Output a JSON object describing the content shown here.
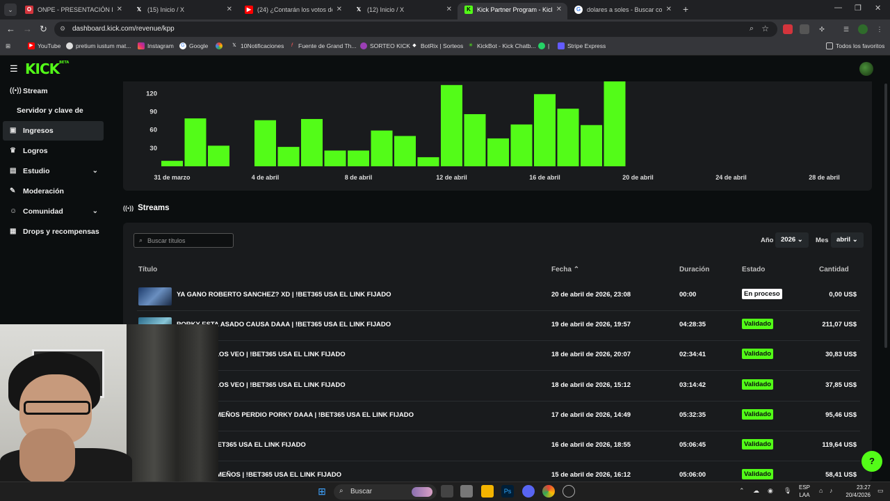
{
  "browser": {
    "tabs": [
      {
        "label": "ONPE - PRESENTACIÓN DE RES",
        "icon": "onpe-icon",
        "color": "#d3343c"
      },
      {
        "label": "(15) Inicio / X",
        "icon": "x-icon",
        "color": "#000000"
      },
      {
        "label": "(24) ¿Contarán los votos de act",
        "icon": "youtube-icon",
        "color": "#ff0000"
      },
      {
        "label": "(12) Inicio / X",
        "icon": "x-icon",
        "color": "#000000"
      },
      {
        "label": "Kick Partner Program - Kick Da",
        "icon": "kick-icon",
        "color": "#53fc18"
      },
      {
        "label": "dolares a soles - Buscar con Go",
        "icon": "google-icon",
        "color": "#4285f4"
      }
    ],
    "url": "dashboard.kick.com/revenue/kpp",
    "bookmarks": [
      {
        "label": "YouTube",
        "icon": "youtube-icon"
      },
      {
        "label": "pretium iustum mat...",
        "icon": "globe-icon"
      },
      {
        "label": "Instagram",
        "icon": "instagram-icon"
      },
      {
        "label": "Google",
        "icon": "google-icon"
      },
      {
        "label": "",
        "icon": "pinwheel-icon"
      },
      {
        "label": "10Notificaciones",
        "icon": "x-icon"
      },
      {
        "label": "Fuente de Grand Th...",
        "icon": "gta-icon"
      },
      {
        "label": "SORTEO KICK",
        "icon": "sorteo-icon"
      },
      {
        "label": "BotRix | Sorteos",
        "icon": "botrix-icon"
      },
      {
        "label": "KickBot - Kick Chatb...",
        "icon": "kickbot-icon"
      },
      {
        "label": "|",
        "icon": "whatsapp-icon"
      },
      {
        "label": "Stripe Express",
        "icon": "stripe-icon"
      }
    ],
    "all_bookmarks": "Todos los favoritos"
  },
  "sidebar": {
    "items": [
      {
        "label": "Stream",
        "icon": "broadcast-icon"
      },
      {
        "label": "Servidor y clave de retransn"
      },
      {
        "label": "Ingresos",
        "icon": "money-icon"
      },
      {
        "label": "Logros",
        "icon": "trophy-icon"
      },
      {
        "label": "Estudio",
        "icon": "studio-icon"
      },
      {
        "label": "Moderación",
        "icon": "wrench-icon"
      },
      {
        "label": "Comunidad",
        "icon": "community-icon"
      },
      {
        "label": "Drops y recompensas",
        "icon": "drops-icon"
      }
    ]
  },
  "chart_data": {
    "type": "bar",
    "color": "#53fc18",
    "x_tick_labels": [
      "31 de marzo",
      "4 de abril",
      "8 de abril",
      "12 de abril",
      "16 de abril",
      "20 de abril",
      "24 de abril",
      "28 de abril"
    ],
    "y_tick_labels": [
      "30",
      "60",
      "90",
      "120"
    ],
    "ylim": [
      0,
      140
    ],
    "days": [
      "31/3",
      "1/4",
      "2/4",
      "3/4",
      "4/4",
      "5/4",
      "6/4",
      "7/4",
      "8/4",
      "9/4",
      "10/4",
      "11/4",
      "12/4",
      "13/4",
      "14/4",
      "15/4",
      "16/4",
      "17/4",
      "18/4",
      "19/4"
    ],
    "values": [
      9,
      79,
      34,
      0,
      76,
      32,
      78,
      26,
      26,
      59,
      50,
      15,
      134,
      86,
      46,
      69,
      119,
      95,
      68,
      142
    ],
    "grid": false
  },
  "streams": {
    "heading": "Streams",
    "search_placeholder": "Buscar títulos",
    "year_label": "Año",
    "year_value": "2026",
    "month_label": "Mes",
    "month_value": "abril",
    "columns": {
      "title": "Título",
      "date": "Fecha",
      "duration": "Duración",
      "status": "Estado",
      "amount": "Cantidad"
    },
    "rows": [
      {
        "title": "YA GANO ROBERTO SANCHEZ? XD | !BET365 USA EL LINK FIJADO",
        "date": "20 de abril de 2026, 23:08",
        "duration": "00:00",
        "status": "En proceso",
        "amount": "0,00 US$"
      },
      {
        "title": "PORKY ESTA ASADO CAUSA DAAA | !BET365 USA EL LINK FIJADO",
        "date": "19 de abril de 2026, 19:57",
        "duration": "04:28:35",
        "status": "Validado",
        "amount": "211,07 US$"
      },
      {
        "title": "SOSTADOS LOS VEO | !BET365 USA EL LINK FIJADO",
        "date": "18 de abril de 2026, 20:07",
        "duration": "02:34:41",
        "status": "Validado",
        "amount": "30,83 US$"
      },
      {
        "title": "SOSTADOS LOS VEO | !BET365 USA EL LINK FIJADO",
        "date": "18 de abril de 2026, 15:12",
        "duration": "03:14:42",
        "status": "Validado",
        "amount": "37,85 US$"
      },
      {
        "title": "LES VEO LEMEÑOS PERDIO PORKY DAAA | !BET365 USA EL LINK FIJADO",
        "date": "17 de abril de 2026, 14:49",
        "duration": "05:32:35",
        "status": "Validado",
        "amount": "95,46 US$"
      },
      {
        "title": "LEMEÑO | !BET365 USA EL LINK FIJADO",
        "date": "16 de abril de 2026, 18:55",
        "duration": "05:06:45",
        "status": "Validado",
        "amount": "119,64 US$"
      },
      {
        "title": "LOS VEO LEMEÑOS | !BET365 USA EL LINK FIJADO",
        "date": "15 de abril de 2026, 16:12",
        "duration": "05:06:00",
        "status": "Validado",
        "amount": "58,41 US$"
      }
    ]
  },
  "taskbar": {
    "search_label": "Buscar",
    "lang_line1": "ESP",
    "lang_line2": "LAA",
    "time": "23:27",
    "date": "20/4/2026"
  }
}
